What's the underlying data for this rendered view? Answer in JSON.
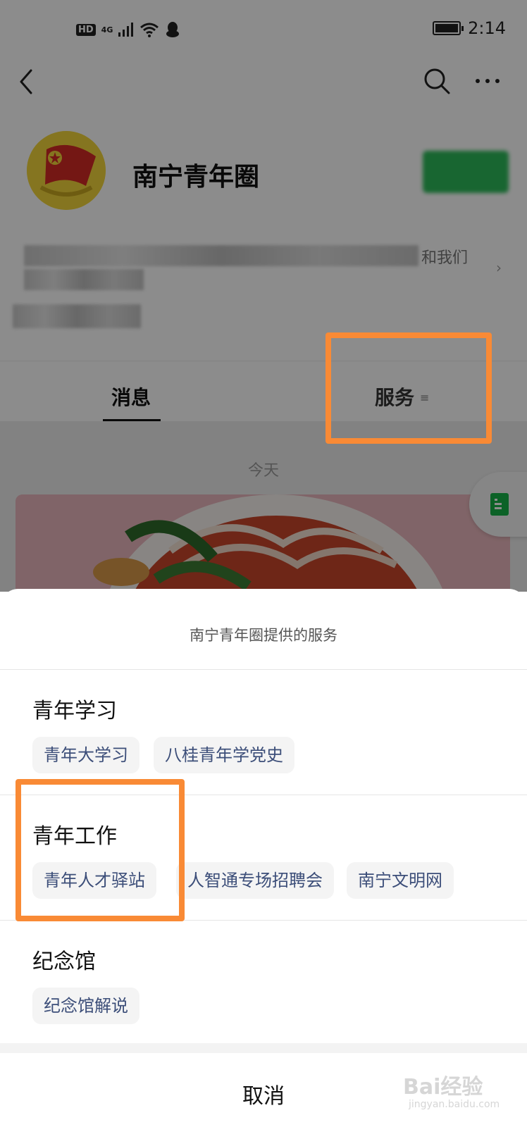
{
  "status_bar": {
    "hd": "HD",
    "network": "4G",
    "time": "2:14"
  },
  "account": {
    "name": "南宁青年圈",
    "description_fragment": "和我们"
  },
  "tabs": [
    {
      "label": "消息"
    },
    {
      "label": "服务"
    }
  ],
  "feed": {
    "date_label": "今天"
  },
  "sheet": {
    "title": "南宁青年圈提供的服务",
    "sections": [
      {
        "title": "青年学习",
        "chips": [
          "青年大学习",
          "八桂青年学党史"
        ]
      },
      {
        "title": "青年工作",
        "chips": [
          "青年人才驿站",
          "人智通专场招聘会",
          "南宁文明网"
        ]
      },
      {
        "title": "纪念馆",
        "chips": [
          "纪念馆解说"
        ]
      }
    ],
    "cancel_label": "取消"
  },
  "watermark": {
    "text": "Bai经验",
    "sub": "jingyan.baidu.com"
  },
  "colors": {
    "highlight": "#f98a35",
    "chip_text": "#3c4e79",
    "follow_green": "#17b348"
  },
  "icons": [
    "back-icon",
    "search-icon",
    "more-icon",
    "menu-icon",
    "document-icon",
    "signal-icon",
    "wifi-icon",
    "qq-icon",
    "battery-icon"
  ]
}
